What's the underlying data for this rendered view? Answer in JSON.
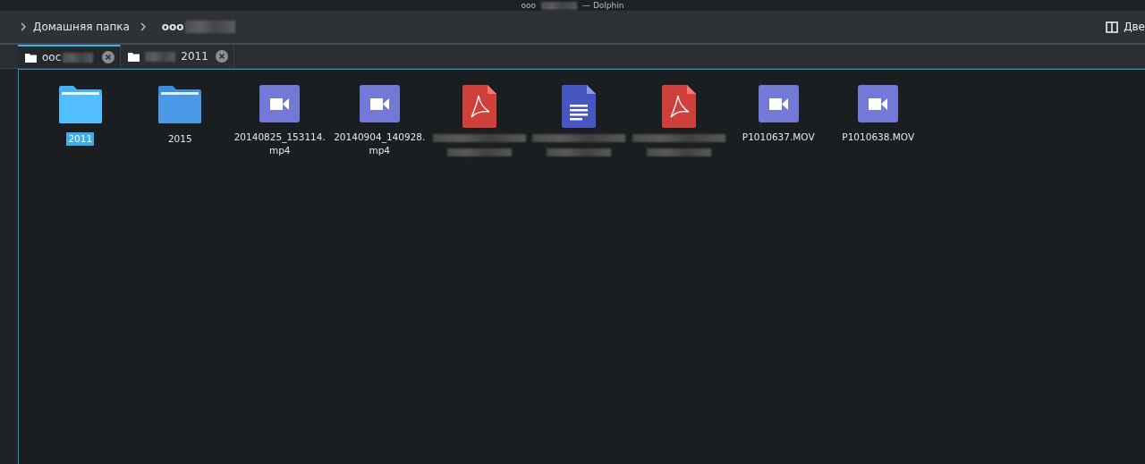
{
  "window": {
    "title_start": "ooo",
    "title_end": "— Dolphin"
  },
  "breadcrumb": [
    {
      "label": "Домашняя папка",
      "current": false,
      "redacted": false
    },
    {
      "label": "ooo",
      "current": true,
      "redacted": true
    }
  ],
  "split_button": {
    "label": "Две"
  },
  "tabs": [
    {
      "label": "ooc",
      "selected": true,
      "blur_first": false
    },
    {
      "label": "2011",
      "selected": false,
      "blur_first": true
    }
  ],
  "items": [
    {
      "kind": "folder",
      "name": "2011",
      "selected": true
    },
    {
      "kind": "folder",
      "name": "2015",
      "selected": false
    },
    {
      "kind": "video",
      "name": "20140825_153114.\nmp4",
      "selected": false
    },
    {
      "kind": "video",
      "name": "20140904_140928.\nmp4",
      "selected": false
    },
    {
      "kind": "pdf",
      "selected": false,
      "redacted": true
    },
    {
      "kind": "document",
      "selected": false,
      "redacted": true
    },
    {
      "kind": "pdf",
      "selected": false,
      "redacted": true
    },
    {
      "kind": "video",
      "name": "P1010637.MOV",
      "selected": false
    },
    {
      "kind": "video",
      "name": "P1010638.MOV",
      "selected": false
    }
  ]
}
